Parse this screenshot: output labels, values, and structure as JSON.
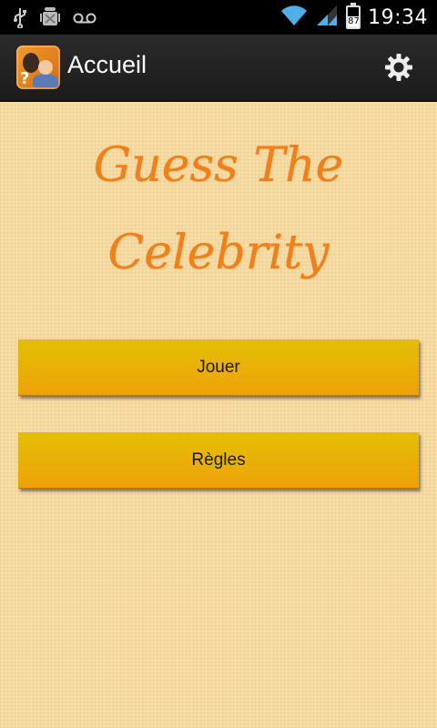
{
  "status_bar": {
    "time": "19:34",
    "battery_level": "87",
    "icons": [
      "usb-icon",
      "android-debug-icon",
      "voicemail-icon",
      "wifi-icon",
      "signal-icon",
      "battery-icon"
    ]
  },
  "action_bar": {
    "title": "Accueil",
    "app_icon": "celebrity-app-icon",
    "settings_icon": "gear-icon"
  },
  "main": {
    "title": "Guess The Celebrity",
    "buttons": [
      {
        "label": "Jouer"
      },
      {
        "label": "Règles"
      }
    ]
  },
  "colors": {
    "background": "#f7dca6",
    "title": "#f0801a",
    "button_top": "#e3bf06",
    "button_bottom": "#efa208"
  }
}
